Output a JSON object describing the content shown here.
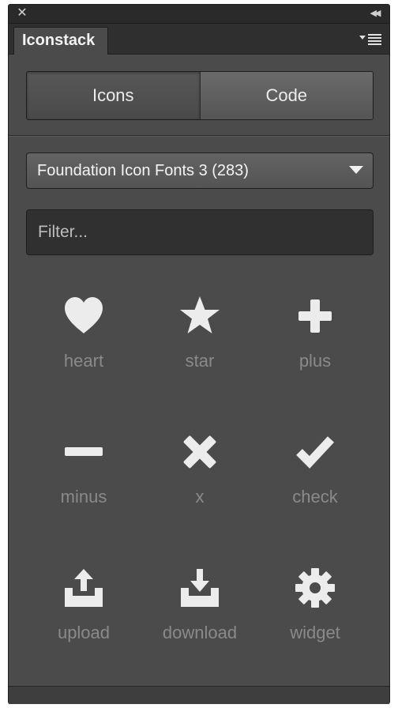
{
  "window": {
    "close_icon": "close-icon",
    "collapse_icon": "double-chevron-left-icon"
  },
  "tab": {
    "title": "Iconstack"
  },
  "segment": {
    "icons_label": "Icons",
    "code_label": "Code",
    "active": "Icons"
  },
  "font_select": {
    "value": "Foundation Icon Fonts 3 (283)"
  },
  "filter": {
    "placeholder": "Filter...",
    "value": ""
  },
  "icons": [
    {
      "label": "heart",
      "icon": "heart-icon"
    },
    {
      "label": "star",
      "icon": "star-icon"
    },
    {
      "label": "plus",
      "icon": "plus-icon"
    },
    {
      "label": "minus",
      "icon": "minus-icon"
    },
    {
      "label": "x",
      "icon": "x-icon"
    },
    {
      "label": "check",
      "icon": "check-icon"
    },
    {
      "label": "upload",
      "icon": "upload-icon"
    },
    {
      "label": "download",
      "icon": "download-icon"
    },
    {
      "label": "widget",
      "icon": "widget-icon"
    }
  ],
  "colors": {
    "panel": "#4b4b4b",
    "icon": "#ececec",
    "icon_label": "#8a8a8a"
  }
}
